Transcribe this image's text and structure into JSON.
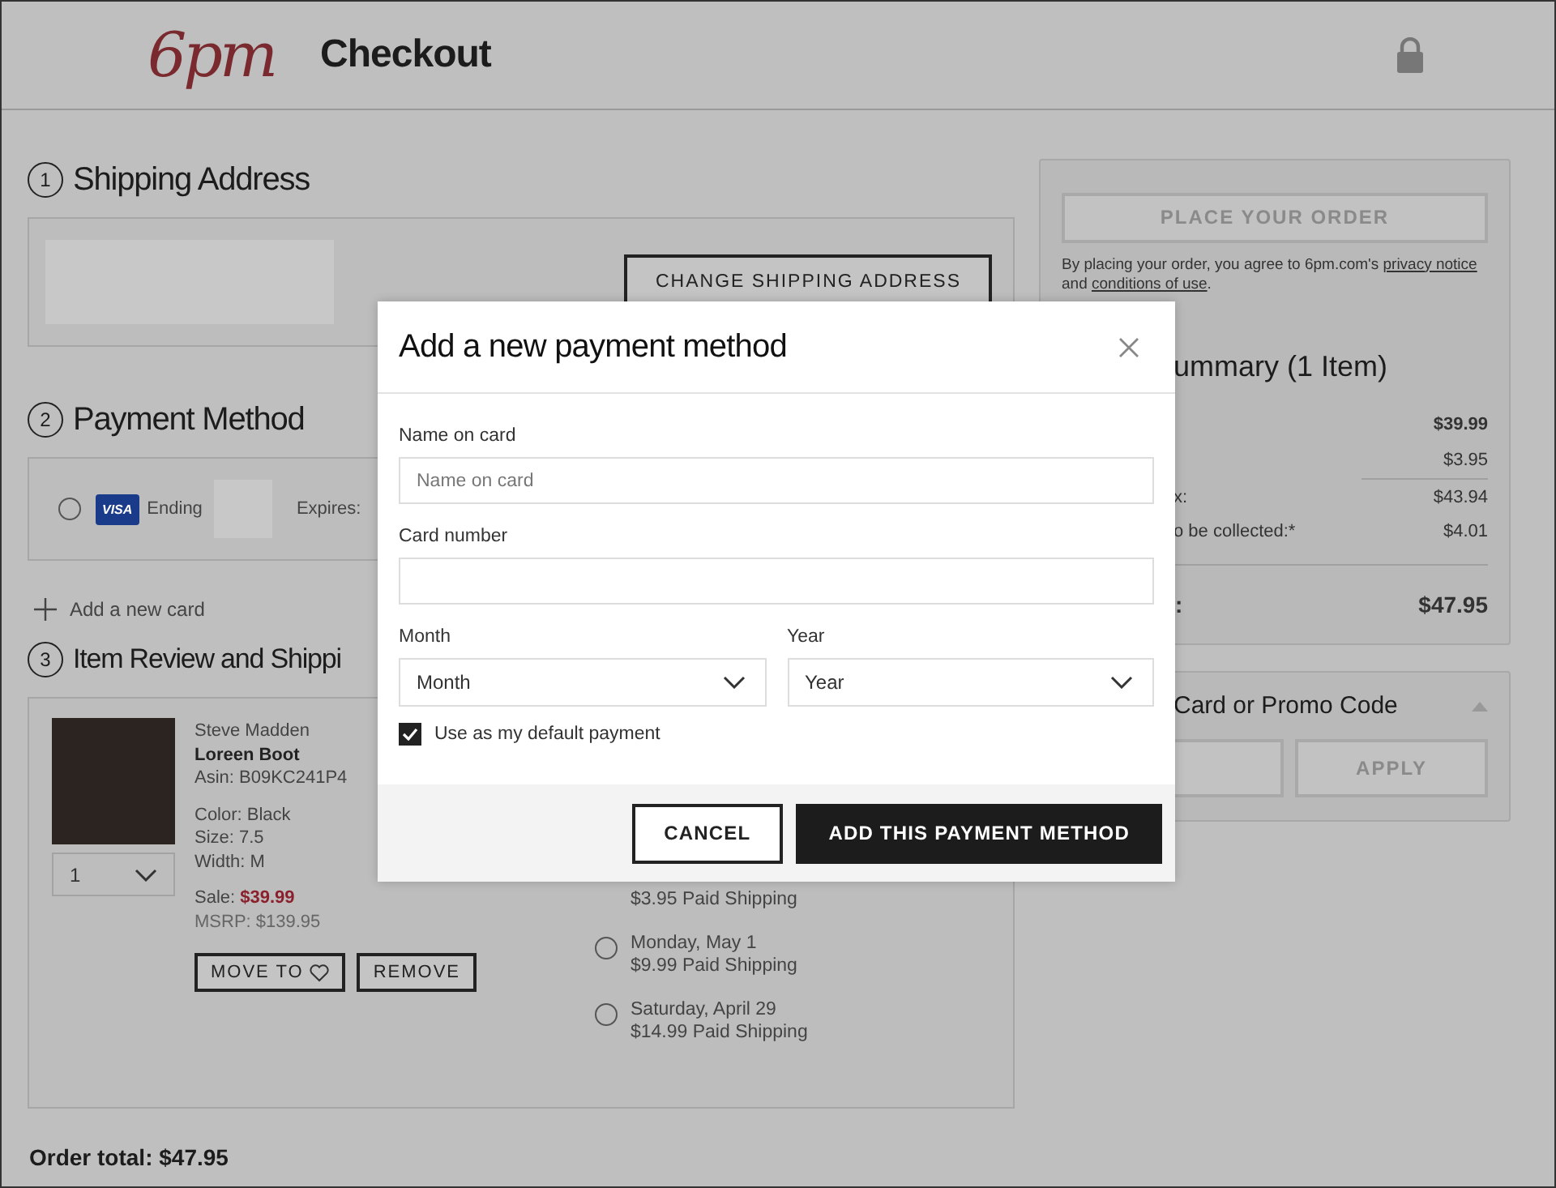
{
  "header": {
    "logo": "6pm",
    "title": "Checkout"
  },
  "shipping_address": {
    "number": "1",
    "title": "Shipping Address",
    "button": "CHANGE SHIPPING ADDRESS"
  },
  "payment_method": {
    "number": "2",
    "title": "Payment Method",
    "cards": [
      {
        "selected": false,
        "brand": "VISA",
        "ending_label": "Ending",
        "expires_label": "Expires:"
      }
    ],
    "add_card": "Add a new card"
  },
  "item_review": {
    "number": "3",
    "title": "Item Review and Shippi",
    "items": [
      {
        "quantity": "1",
        "brand": "Steve Madden",
        "name": "Loreen Boot",
        "asin": "Asin: B09KC241P4",
        "color_label": "Color: Black",
        "size": "Size: 7.5",
        "width": "Width: M",
        "sale_label": "Sale:",
        "sale_price": "$39.99",
        "msrp": "MSRP: $139.95",
        "move_button": "MOVE TO",
        "remove_button": "REMOVE"
      }
    ],
    "shipping_options": [
      {
        "price": "$3.95 Paid Shipping"
      },
      {
        "selected": false,
        "date": "Monday, May 1",
        "price": "$9.99 Paid Shipping"
      },
      {
        "selected": false,
        "date": "Saturday, April 29",
        "price": "$14.99 Paid Shipping"
      }
    ]
  },
  "order_total": "Order total: $47.95",
  "sidebar": {
    "place_order": {
      "label": "PLACE YOUR ORDER",
      "disabled": true
    },
    "agreement": [
      {
        "kind": "text",
        "text": "By placing your order, you agree to 6pm.com's "
      },
      {
        "kind": "link",
        "text": "privacy notice"
      },
      {
        "kind": "text",
        "text": " and "
      },
      {
        "kind": "link",
        "text": "conditions of use"
      },
      {
        "kind": "text",
        "text": "."
      }
    ],
    "summary_title": "ummary (1 Item)",
    "summary_rows": [
      {
        "kind": "bold",
        "value": "$39.99"
      },
      {
        "kind": "plain",
        "value": "$3.95"
      },
      {
        "kind": "subtotal",
        "label": "x:",
        "value": "$43.94"
      },
      {
        "kind": "plain",
        "label": "o be collected:*",
        "value": "$4.01"
      },
      {
        "kind": "total",
        "label": ":",
        "value": "$47.95"
      }
    ],
    "promo": {
      "title": "Card or Promo Code",
      "expanded": true,
      "button": "APPLY"
    }
  },
  "modal": {
    "title": "Add a new payment method",
    "fields": [
      {
        "kind": "text",
        "label": "Name on card",
        "placeholder": "Name on card"
      },
      {
        "kind": "text",
        "label": "Card number"
      },
      {
        "kind": "select",
        "label": "Month",
        "value": "Month"
      },
      {
        "kind": "select",
        "label": "Year",
        "value": "Year"
      }
    ],
    "default_checkbox": {
      "label": "Use as my default payment",
      "checked": true
    },
    "buttons": [
      {
        "kind": "secondary",
        "label": "CANCEL"
      },
      {
        "kind": "primary",
        "label": "ADD THIS PAYMENT METHOD"
      }
    ]
  }
}
